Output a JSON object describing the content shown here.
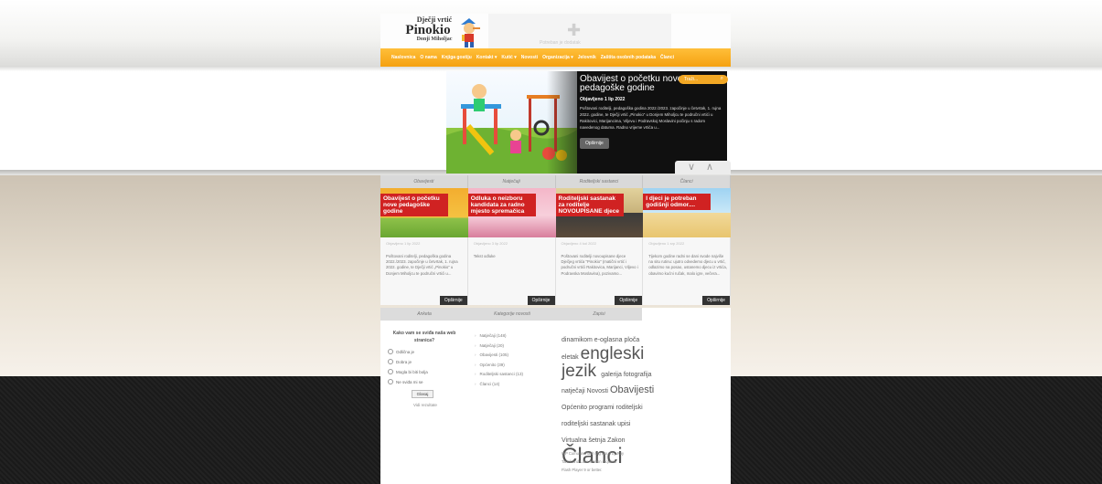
{
  "logo": {
    "top": "Dječji vrtić",
    "main": "Pinokio",
    "sub": "Donji Miholjac"
  },
  "plugin": {
    "text": "Potreban je dodatak"
  },
  "nav": [
    "Naslovnica",
    "O nama",
    "Knjiga gostiju",
    "Kontakt ▾",
    "Kutić ▾",
    "Novosti",
    "Organizacija ▾",
    "Jelovnik",
    "Zaštita osobnih podataka",
    "Članci"
  ],
  "search": {
    "placeholder": "Traži..."
  },
  "slider": {
    "title": "Obavijest o početku nove pedagoške godine",
    "date": "Objavljeno 1 lip 2022",
    "desc": "Poštovani roditelji, pedagoška godina 2022./2023. započinje u četvrtak, 1. rujna 2022. godine, te Dječji vrtić „Pinokio“ u Donjem Miholjcu te područni vrtići u Rakitovici, Marijancima, Viljevu i Podravskoj Moslavini počinju s radom navedenog datuma. Radno vrijeme vrtića u...",
    "button": "Opširnije"
  },
  "toggle": {
    "down": "∨",
    "up": "∧"
  },
  "tabs": [
    "Obavijesti",
    "Natječaji",
    "Roditeljski sastanci",
    "Članci"
  ],
  "cards": [
    {
      "title": "Obavijest o početku nove pedagoške godine",
      "date": "Objavljeno 1 lip 2022",
      "text": "Poštovani roditelji, pedagoška godina 2022./2023. započinje u četvrtak, 1. rujna 2022. godine, te Dječji vrtić „Pinokio“ u Donjem Miholjcu te područni vrtići u...",
      "button": "Opširnije"
    },
    {
      "title": "Odluka o neizboru kandidata za radno mjesto spremačica",
      "date": "Objavljeno 3 lip 2022",
      "text": "Tekst odluke",
      "button": "Opširnije"
    },
    {
      "title": "Roditeljski sastanak za roditelje NOVOUPISANE djece",
      "date": "Objavljeno 4 kol 2022",
      "text": "Poštovani roditelji novoupisane djece Dječjeg vrtića \"Pinokio\" (matični vrtić i područni vrtići Rakitovica, Marijanci, Viljevo i Podravska Moslavina), pozivamo...",
      "button": "Opširnije"
    },
    {
      "title": "I djeci je potreban godišnji odmor....",
      "date": "Objavljeno 1 srp 2022",
      "text": "Tijekom godine radni se dani svode najviše na situ rutinu: ujutro odvedemo djecu u vrtić, odlazimo na posao, ustanemo djecu iz vrtića, obavimo kućni ručak, malo igre, večera...",
      "button": "Opširnije"
    }
  ],
  "bottom": {
    "headers": [
      "Anketa",
      "Kategorije novosti",
      "Zapisi"
    ],
    "poll": {
      "question": "Kako vam se sviđa naša web stranica?",
      "options": [
        "Odlična je",
        "Dobra je",
        "Mogla bi biti bolja",
        "Ne sviđa mi se"
      ],
      "vote": "Glasaj",
      "results": "Vidi rezultate"
    },
    "categories": [
      "Natječaji (148)",
      "Natječaji (20)",
      "Obavijesti (105)",
      "Općenito (39)",
      "Roditeljski sastanci (13)",
      "Članci (14)"
    ],
    "tags": [
      {
        "text": "dinamikom",
        "size": 7
      },
      {
        "text": "e-oglasna",
        "size": 7
      },
      {
        "text": "ploča",
        "size": 7
      },
      {
        "text": "eletak",
        "size": 7
      },
      {
        "text": "engleski jezik",
        "size": 19
      },
      {
        "text": "galerija",
        "size": 7
      },
      {
        "text": "fotografija",
        "size": 7
      },
      {
        "text": "natječaji",
        "size": 7
      },
      {
        "text": "Novosti",
        "size": 7
      },
      {
        "text": "Obavijesti",
        "size": 11
      },
      {
        "text": "Općenito",
        "size": 7
      },
      {
        "text": "programi",
        "size": 7
      },
      {
        "text": "roditeljski",
        "size": 7
      },
      {
        "text": "roditeljski sastanak",
        "size": 7
      },
      {
        "text": "upisi",
        "size": 7
      },
      {
        "text": "Virtualna šetnja",
        "size": 7
      },
      {
        "text": "Zakon",
        "size": 7
      },
      {
        "text": "Članci",
        "size": 24
      }
    ],
    "flash_lines": [
      "WP Cumulus Flash tag cloud by Roy",
      "Tanck and Luke Morton requires",
      "Flash Player 9 or better."
    ]
  }
}
